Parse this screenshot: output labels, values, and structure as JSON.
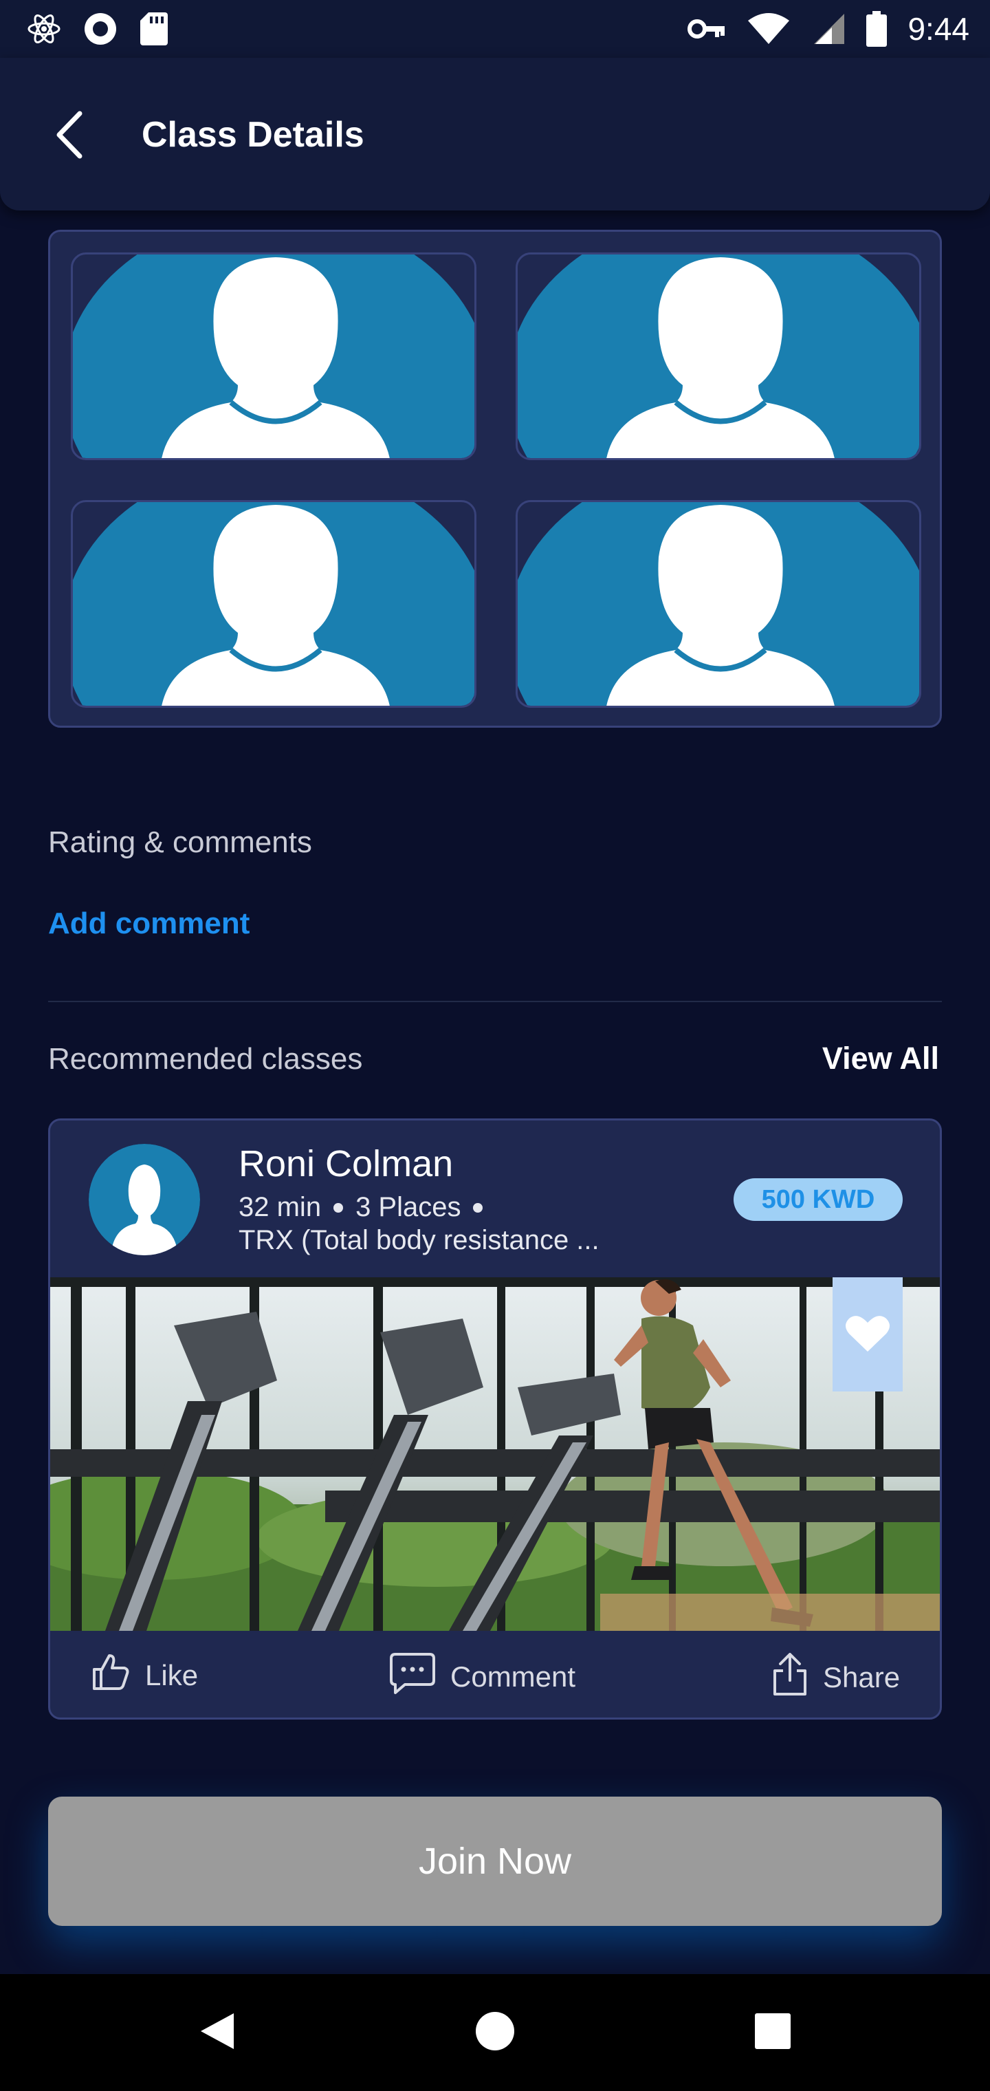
{
  "status_bar": {
    "time": "9:44",
    "left_icons": [
      "atom-icon",
      "record-icon",
      "sd-card-icon"
    ],
    "right_icons": [
      "key-icon",
      "wifi-icon",
      "signal-icon",
      "battery-icon"
    ]
  },
  "app_bar": {
    "title": "Class Details",
    "back_icon": "chevron-left-icon"
  },
  "participants": {
    "count": 4
  },
  "rating": {
    "heading": "Rating & comments",
    "add_comment_label": "Add comment"
  },
  "recommended": {
    "heading": "Recommended classes",
    "view_all_label": "View All",
    "card": {
      "coach_name": "Roni Colman",
      "duration": "32 min",
      "places": "3 Places",
      "description": "TRX (Total body resistance ...",
      "price": "500 KWD",
      "favorite_icon": "heart-icon",
      "actions": {
        "like": "Like",
        "comment": "Comment",
        "share": "Share"
      }
    }
  },
  "join_button": {
    "label": "Join Now"
  },
  "colors": {
    "background": "#0a0f2b",
    "card": "#1f2850",
    "accent": "#1e90f0",
    "avatar_blue": "#1a7fb0",
    "badge": "#9fd0f6",
    "disabled_button": "#9b9b9b"
  }
}
